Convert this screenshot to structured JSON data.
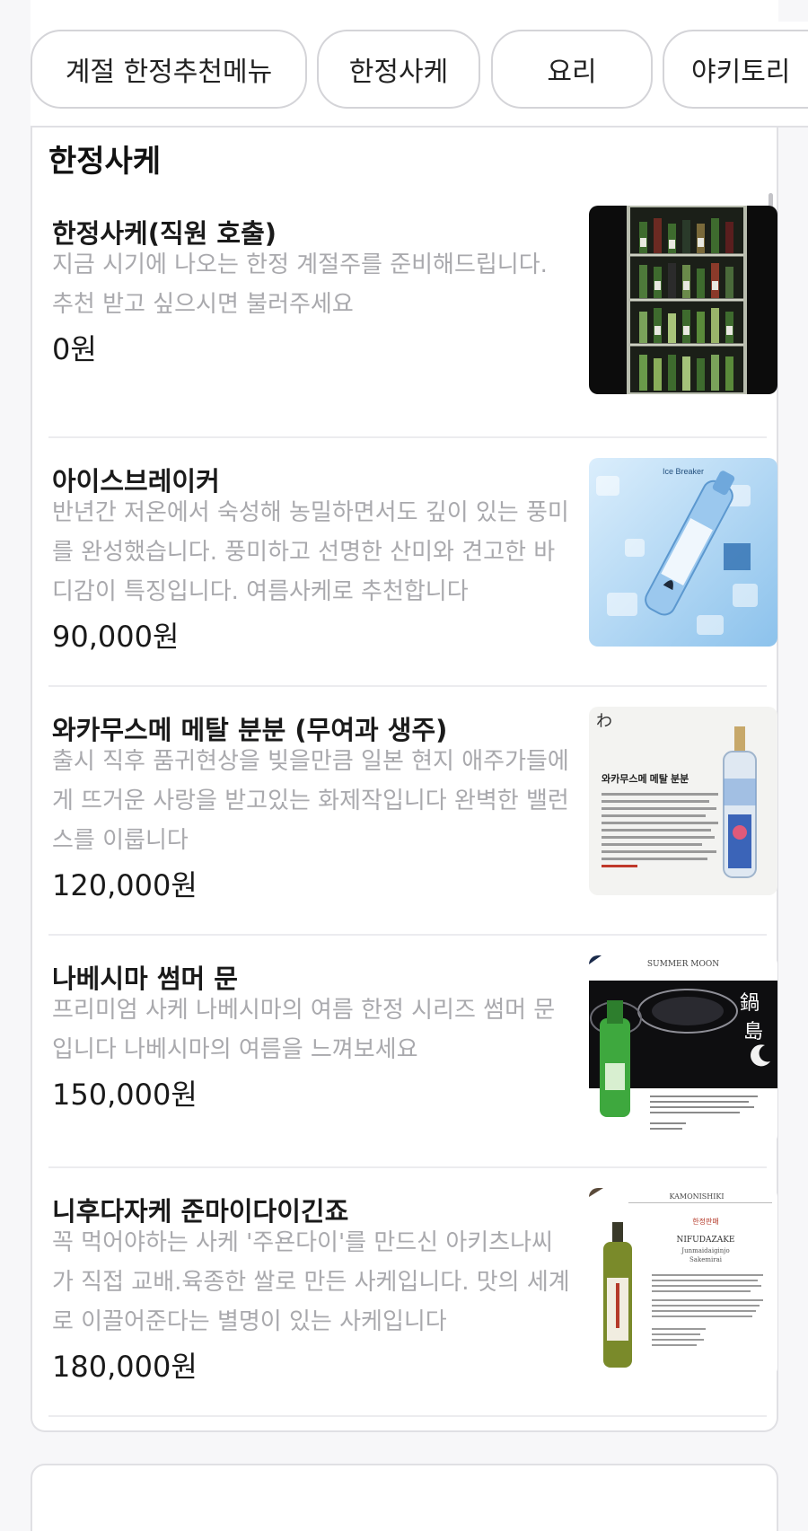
{
  "tabs": [
    {
      "label": "계절 한정추천메뉴"
    },
    {
      "label": "한정사케"
    },
    {
      "label": "요리"
    },
    {
      "label": "야키토리"
    }
  ],
  "section": {
    "title": "한정사케"
  },
  "items": [
    {
      "name": "한정사케(직원 호출)",
      "description": "지금 시기에 나오는 한정 계절주를 준비해드립니다. 추천 받고 싶으시면 불러주세요",
      "price": "0원",
      "image": "sake-fridge-photo"
    },
    {
      "name": "아이스브레이커",
      "description": "반년간 저온에서 숙성해 농밀하면서도 깊이 있는 풍미를 완성했습니다. 풍미하고 선명한 산미와 견고한 바디감이 특징입니다. 여름사케로 추천합니다",
      "price": "90,000원",
      "image": "icebreaker-bottle-on-ice",
      "image_text": "Ice Breaker"
    },
    {
      "name": "와카무스메 메탈 분분 (무여과 생주)",
      "description": "출시 직후 품귀현상을 빚을만큼 일본 현지 애주가들에게 뜨거운 사랑을 받고있는 화제작입니다 완벽한 밸런스를 이룹니다",
      "price": "120,000원",
      "image": "wakamusume-metal-bunbun-flyer",
      "image_text": "와카무스메 메탈 분분"
    },
    {
      "name": "나베시마 썸머 문",
      "description": "프리미엄 사케 나베시마의 여름 한정 시리즈 썸머 문입니다 나베시마의 여름을 느껴보세요",
      "price": "150,000원",
      "image": "nabeshima-summer-moon-poster",
      "image_text": "SUMMER MOON"
    },
    {
      "name": "니후다자케 준마이다이긴죠",
      "description": "꼭 먹어야하는 사케 '주욘다이'를 만드신 아키츠나씨가 직접 교배.육종한 쌀로 만든 사케입니다. 맛의 세계로 이끌어준다는 별명이 있는 사케입니다",
      "price": "180,000원",
      "image": "nifudazake-bottle-flyer",
      "image_text": "KAMONISHIKI",
      "image_text_2": "NIFUDAZAKE",
      "image_text_3": "Junmaidaiginjo",
      "image_text_4": "Sakemirai"
    }
  ],
  "colors": {
    "background": "#f7f7f9",
    "card": "#ffffff",
    "border": "#e0e0e4",
    "description": "#a9a9ad",
    "text": "#1a1a1a"
  }
}
